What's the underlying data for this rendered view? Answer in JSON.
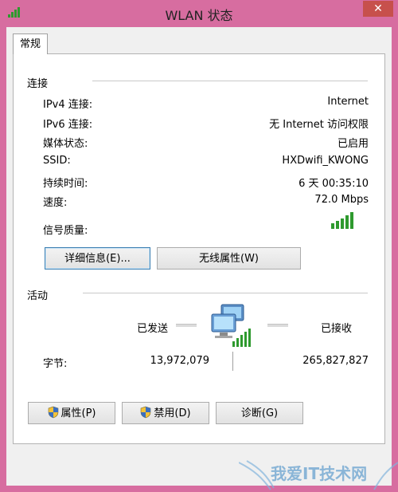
{
  "window": {
    "title": "WLAN 状态",
    "close_glyph": "✕"
  },
  "tabs": [
    {
      "label": "常规"
    }
  ],
  "connection": {
    "section_title": "连接",
    "rows": [
      {
        "label": "IPv4 连接:",
        "value": "Internet"
      },
      {
        "label": "IPv6 连接:",
        "value": "无 Internet 访问权限"
      },
      {
        "label": "媒体状态:",
        "value": "已启用"
      },
      {
        "label": "SSID:",
        "value": "HXDwifi_KWONG"
      },
      {
        "label": "持续时间:",
        "value": "6 天 00:35:10"
      },
      {
        "label": "速度:",
        "value": "72.0 Mbps"
      }
    ],
    "signal_label": "信号质量:",
    "signal_bars": 5,
    "details_button": "详细信息(E)...",
    "wireless_props_button": "无线属性(W)"
  },
  "activity": {
    "section_title": "活动",
    "sent_label": "已发送",
    "received_label": "已接收",
    "bytes_label": "字节:",
    "bytes_sent": "13,972,079",
    "bytes_received": "265,827,827"
  },
  "buttons": {
    "properties": "属性(P)",
    "disable": "禁用(D)",
    "diagnose": "诊断(G)"
  },
  "watermark": "我爱IT技术网",
  "colors": {
    "titlebar": "#d76da0",
    "close": "#c7504c",
    "signal": "#2e9a2e"
  }
}
